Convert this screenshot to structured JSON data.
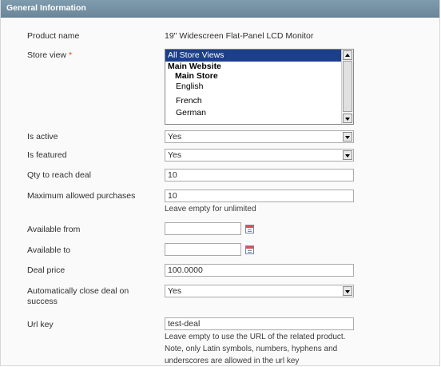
{
  "section": {
    "title": "General Information"
  },
  "fields": {
    "product_name": {
      "label": "Product name",
      "value": "19\" Widescreen Flat-Panel LCD Monitor"
    },
    "store_view": {
      "label": "Store view",
      "required_mark": "*",
      "options": [
        {
          "label": "All Store Views",
          "selected": true,
          "kind": "option"
        },
        {
          "label": "Main Website",
          "kind": "group"
        },
        {
          "label": "Main Store",
          "kind": "subgroup"
        },
        {
          "label": "English",
          "kind": "option-indented"
        },
        {
          "label": "French",
          "kind": "option-indented"
        },
        {
          "label": "German",
          "kind": "option-indented"
        }
      ]
    },
    "is_active": {
      "label": "Is active",
      "value": "Yes"
    },
    "is_featured": {
      "label": "Is featured",
      "value": "Yes"
    },
    "qty_to_reach_deal": {
      "label": "Qty to reach deal",
      "value": "10"
    },
    "max_allowed_purchases": {
      "label": "Maximum allowed purchases",
      "value": "10",
      "note": "Leave empty for unlimited"
    },
    "available_from": {
      "label": "Available from",
      "value": "",
      "icon": "calendar-icon"
    },
    "available_to": {
      "label": "Available to",
      "value": "",
      "icon": "calendar-icon"
    },
    "deal_price": {
      "label": "Deal price",
      "value": "100.0000"
    },
    "auto_close": {
      "label_line1": "Automatically close deal on",
      "label_line2": "success",
      "value": "Yes"
    },
    "url_key": {
      "label": "Url key",
      "value": "test-deal",
      "note_line1": "Leave empty to use the URL of the related product.",
      "note_line2": "Note, only Latin symbols, numbers, hyphens and",
      "note_line3": "underscores are allowed in the url key"
    }
  },
  "colors": {
    "header_bg": "#7592a6",
    "required": "#eb340a",
    "selected_option": "#1c3f8c"
  }
}
